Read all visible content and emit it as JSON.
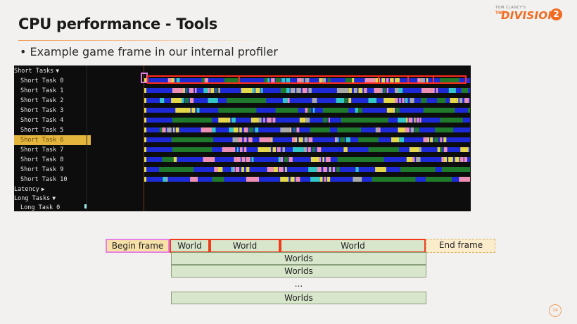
{
  "slide": {
    "title": "CPU performance - Tools",
    "bullet": "• Example game frame in our internal profiler",
    "page_number": "14"
  },
  "logo": {
    "publisher": "TOM CLANCY'S",
    "prefix": "THE",
    "word": "DIVISION",
    "number": "2"
  },
  "profiler": {
    "groups": [
      {
        "label": "Short Tasks",
        "expanded": true
      },
      {
        "label": "Latency",
        "expanded": false
      },
      {
        "label": "Long Tasks",
        "expanded": true
      }
    ],
    "short_tasks": [
      "Short Task 0",
      "Short Task 1",
      "Short Task 2",
      "Short Task 3",
      "Short Task 4",
      "Short Task 5",
      "Short Task 6",
      "Short Task 7",
      "Short Task 8",
      "Short Task 9",
      "Short Task 10"
    ],
    "long_tasks": [
      "Long Task 0"
    ],
    "highlighted_row": "Short Task 6",
    "colors": {
      "background": "#0d0d0d",
      "track": "#1d2ad6",
      "task_green": "#1f7a2c",
      "task_yellow": "#e5d84a",
      "task_pink": "#ee8fb4",
      "task_cyan": "#33c6c6",
      "task_gray": "#a8a8a8",
      "selection_red": "#ff2a1a",
      "selection_pink": "#e07fe0",
      "highlight": "#e3b53d"
    }
  },
  "diagram": {
    "begin_frame": "Begin frame",
    "end_frame": "End frame",
    "world_row": [
      "World",
      "World",
      "World"
    ],
    "worlds_rows": [
      "Worlds",
      "Worlds",
      "...",
      "Worlds"
    ]
  }
}
